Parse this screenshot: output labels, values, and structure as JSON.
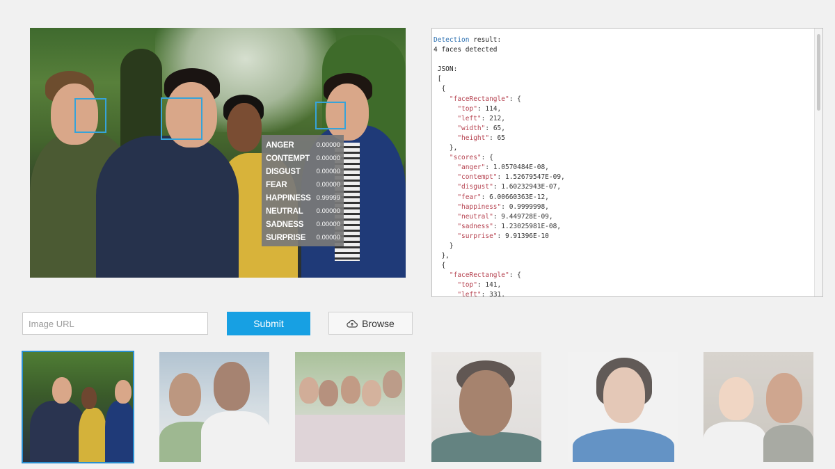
{
  "main_image": {
    "emotions": [
      {
        "label": "ANGER",
        "value": "0.00000"
      },
      {
        "label": "CONTEMPT",
        "value": "0.00000"
      },
      {
        "label": "DISGUST",
        "value": "0.00000"
      },
      {
        "label": "FEAR",
        "value": "0.00000"
      },
      {
        "label": "HAPPINESS",
        "value": "0.99999"
      },
      {
        "label": "NEUTRAL",
        "value": "0.00000"
      },
      {
        "label": "SADNESS",
        "value": "0.00000"
      },
      {
        "label": "SURPRISE",
        "value": "0.00000"
      }
    ],
    "face_box_color": "#36a3d9"
  },
  "result": {
    "title_word": "Detection",
    "title_rest": " result:",
    "summary": "4 faces detected",
    "json_lines": [
      " JSON:",
      " [",
      "  {",
      "    \"faceRectangle\": {",
      "      \"top\": 114,",
      "      \"left\": 212,",
      "      \"width\": 65,",
      "      \"height\": 65",
      "    },",
      "    \"scores\": {",
      "      \"anger\": 1.0570484E-08,",
      "      \"contempt\": 1.52679547E-09,",
      "      \"disgust\": 1.60232943E-07,",
      "      \"fear\": 6.00660363E-12,",
      "      \"happiness\": 0.9999998,",
      "      \"neutral\": 9.449728E-09,",
      "      \"sadness\": 1.23025981E-08,",
      "      \"surprise\": 9.91396E-10",
      "    }",
      "  },",
      "  {",
      "    \"faceRectangle\": {",
      "      \"top\": 141,",
      "      \"left\": 331,"
    ]
  },
  "controls": {
    "url_placeholder": "Image URL",
    "submit_label": "Submit",
    "browse_label": "Browse"
  },
  "colors": {
    "accent": "#17a0e3",
    "selected_border": "#2a8fcf"
  }
}
